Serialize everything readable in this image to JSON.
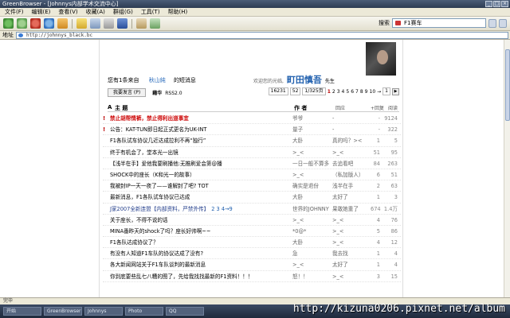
{
  "window": {
    "title": "GreenBrowser - [Johnnys内部学术交流中心]",
    "controls": [
      "_",
      "□",
      "×"
    ]
  },
  "menu": [
    "文件(F)",
    "编辑(E)",
    "查看(V)",
    "收藏(A)",
    "群组(G)",
    "工具(T)",
    "帮助(H)"
  ],
  "toolbar": {
    "search_label": "搜索",
    "search_value": "F1赛车",
    "icons": [
      "back-icon",
      "forward-icon",
      "stop-icon",
      "refresh-icon",
      "home-icon",
      "favorites-icon",
      "history-icon",
      "print-icon",
      "save-icon",
      "mail-icon",
      "options-icon"
    ]
  },
  "address": {
    "label": "地址",
    "url": "http://johnnys_black.bc"
  },
  "header": {
    "welcome_prefix": "您有1条来自",
    "sender": "秋山純",
    "unread_suffix": "的短消息",
    "welcome_text": "欢迎您的光临,",
    "username": "町田慎吾",
    "honorific": "先生"
  },
  "actions": {
    "post_button": "我要发言 (P)",
    "rss_label": "藉华",
    "rss_value": "RSS2.0"
  },
  "pager": {
    "total": "16231",
    "per_page": "52",
    "page_of": "1/325页",
    "pages": [
      "1",
      "2",
      "3",
      "4",
      "5",
      "6",
      "7",
      "8",
      "9",
      "10"
    ],
    "current": "1",
    "next": "→",
    "jump_value": "1"
  },
  "table": {
    "headers": {
      "mark": "A",
      "title": "主 题",
      "author": "作 者",
      "reply": "回应",
      "replies": "+回复",
      "views": "阅读"
    },
    "rows": [
      {
        "mark": "!",
        "title": "禁止胡帮情裤，禁止得利出道事宜",
        "style": "red",
        "author": "爷爷",
        "reply": "-",
        "n1": "-",
        "n2": "9124"
      },
      {
        "mark": "!",
        "title": "公告：KAT-TUN即日起正式更名为UK-INT",
        "style": "normal",
        "author": "量子",
        "reply": "-",
        "n1": "-",
        "n2": "322"
      },
      {
        "mark": "",
        "title": "F1各队试车协议几近达成拉利不再“独行”",
        "style": "normal",
        "author": "大卧",
        "reply": "真的吗？><",
        "n1": "1",
        "n2": "5"
      },
      {
        "mark": "",
        "title": "终于有机会了，堂本光一出镜",
        "style": "normal",
        "author": ">_<",
        "reply": ">_<",
        "n1": "51",
        "n2": "95"
      },
      {
        "mark": "",
        "title": "【浅半在手】爱他我要刷播他:无推刷爱会第@播",
        "style": "normal",
        "author": "一日一般不算多",
        "reply": "去追看吧",
        "n1": "84",
        "n2": "263"
      },
      {
        "mark": "",
        "title": "SHOCK中的座长（K和光一的故事）",
        "style": "normal",
        "author": ">_<",
        "reply": "（私加版人）",
        "n1": "6",
        "n2": "51"
      },
      {
        "mark": "",
        "title": "我被封IP一天一夜了——谁解封了吧? TOT",
        "style": "normal",
        "author": "确实是退份",
        "reply": "浅半在手",
        "n1": "2",
        "n2": "63"
      },
      {
        "mark": "",
        "title": "最新消息，F1各队试车协议已达成",
        "style": "normal",
        "author": "大卧",
        "reply": "太好了",
        "n1": "1",
        "n2": "3"
      },
      {
        "mark": "",
        "title": "J家2007全新连盟【内部资料，严禁外传】",
        "style": "blue",
        "pages": "2 3 4→9",
        "author": "世界的JOHNNY",
        "reply": "果敢她重了",
        "n1": "674",
        "n2": "1.4万"
      },
      {
        "mark": "",
        "title": "关于座长，不得不说的话",
        "style": "normal",
        "author": ">_<",
        "reply": ">_<",
        "n1": "4",
        "n2": "76"
      },
      {
        "mark": "",
        "title": "MINA番昨天的shock了吗？座长好帅啊~~",
        "style": "normal",
        "author": "*0@*",
        "reply": ">_<",
        "n1": "5",
        "n2": "86"
      },
      {
        "mark": "",
        "title": "F1各队达成协议了？",
        "style": "normal",
        "author": "大卧",
        "reply": ">_<",
        "n1": "4",
        "n2": "12"
      },
      {
        "mark": "",
        "title": "有没有人知道F1车队的协议达成了没有?",
        "style": "normal",
        "author": "急",
        "reply": "我去找",
        "n1": "1",
        "n2": "4"
      },
      {
        "mark": "",
        "title": "各大新闻网站关于F1车队谈判的最新消息",
        "style": "normal",
        "author": ">_<",
        "reply": "太好了",
        "n1": "1",
        "n2": "4"
      },
      {
        "mark": "",
        "title": "你到底要些乱七八糟的图了，先给我找找最新的F1资料！！！",
        "style": "normal",
        "author": "怒！！",
        "reply": ">_<",
        "n1": "3",
        "n2": "15"
      }
    ]
  },
  "statusbar": {
    "text": "完毕"
  },
  "taskbar": [
    "开始",
    "GreenBrowser",
    "Johnnys",
    "Photo",
    "QQ"
  ],
  "watermark": "http://kizuna0206.pixnet.net/album"
}
